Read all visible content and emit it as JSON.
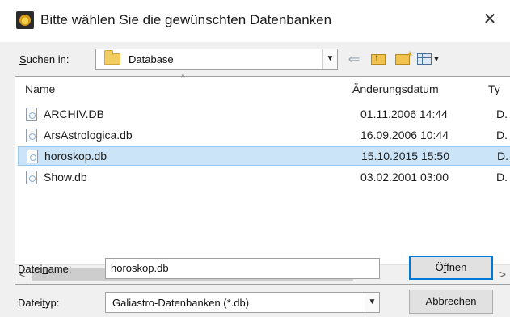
{
  "window": {
    "title": "Bitte wählen Sie die gewünschten Datenbanken",
    "close_glyph": "✕",
    "app_icon": "astro-app-icon"
  },
  "toolbar": {
    "lookin_label_prefix": "S",
    "lookin_label_rest": "uchen in:",
    "lookin_value": "Database",
    "back_icon": "back-arrow-icon",
    "up_icon": "up-folder-icon",
    "new_folder_icon": "new-folder-icon",
    "view_icon": "view-menu-icon"
  },
  "filelist": {
    "columns": {
      "name": "Name",
      "date": "Änderungsdatum",
      "type": "Ty"
    },
    "rows": [
      {
        "name": "ARCHIV.DB",
        "date": "01.11.2006 14:44",
        "type": "D."
      },
      {
        "name": "ArsAstrologica.db",
        "date": "16.09.2006 10:44",
        "type": "D."
      },
      {
        "name": "horoskop.db",
        "date": "15.10.2015 15:50",
        "type": "D.",
        "selected": true
      },
      {
        "name": "Show.db",
        "date": "03.02.2001 03:00",
        "type": "D."
      }
    ],
    "scroll_left": "<",
    "scroll_right": ">"
  },
  "form": {
    "filename_label_a": "Datei",
    "filename_label_u": "n",
    "filename_label_b": "ame:",
    "filename_value": "horoskop.db",
    "filetype_label_a": "Datei",
    "filetype_label_u": "t",
    "filetype_label_b": "yp:",
    "filetype_value": "Galiastro-Datenbanken (*.db)"
  },
  "buttons": {
    "open_a": "Ö",
    "open_u": "f",
    "open_b": "fnen",
    "cancel": "Abbrechen"
  },
  "colors": {
    "selection_bg": "#cce4f7",
    "selection_border": "#99c9ef",
    "default_button_border": "#0078d7"
  }
}
